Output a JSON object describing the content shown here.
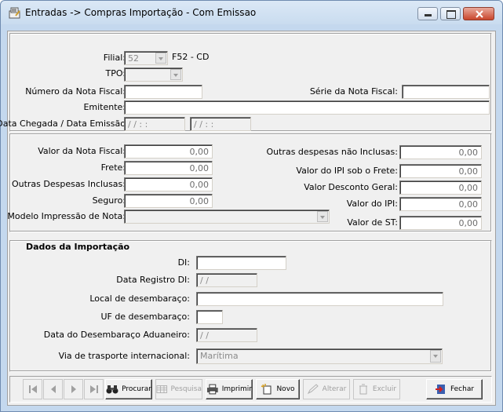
{
  "window": {
    "title": "Entradas -> Compras Importação - Com Emissao"
  },
  "header": {
    "filial_label": "Filial:",
    "filial_value": "52",
    "filial_desc": "F52 - CD",
    "tpo_label": "TPO:",
    "nota_label": "Número da Nota Fiscal:",
    "serie_label": "Série da Nota Fiscal:",
    "emitente_label": "Emitente:",
    "datas_label": "Data Chegada / Data Emissão",
    "data_chegada": "/ /    :  :",
    "data_emissao": "/ /    :  :"
  },
  "valores": {
    "valor_nf_label": "Valor da Nota Fiscal:",
    "valor_nf": "0,00",
    "frete_label": "Frete:",
    "frete": "0,00",
    "outras_inclusas_label": "Outras Despesas Inclusas:",
    "outras_inclusas": "0,00",
    "seguro_label": "Seguro:",
    "seguro": "0,00",
    "modelo_label": "Modelo Impressão de Nota:",
    "outras_nao_inclusas_label": "Outras despesas não Inclusas:",
    "outras_nao_inclusas": "0,00",
    "ipi_frete_label": "Valor do IPI sob o Frete:",
    "ipi_frete": "0,00",
    "desconto_label": "Valor Desconto Geral:",
    "desconto": "0,00",
    "ipi_label": "Valor do IPI:",
    "ipi": "0,00",
    "st_label": "Valor de ST:",
    "st": "0,00"
  },
  "importacao": {
    "section_title": "Dados da Importação",
    "di_label": "DI:",
    "data_registro_label": "Data Registro DI:",
    "data_registro": "/ /",
    "local_label": "Local de desembaraço:",
    "uf_label": "UF de desembaraço:",
    "data_desembaraco_label": "Data do Desembaraço Aduaneiro:",
    "data_desembaraco": "/ /",
    "via_label": "Via de trasporte internacional:",
    "via_value": "Marítima"
  },
  "toolbar": {
    "procurar": "Procurar",
    "pesquisa": "Pesquisa",
    "imprimir": "Imprimir",
    "novo": "Novo",
    "alterar": "Alterar",
    "excluir": "Excluir",
    "fechar": "Fechar"
  }
}
